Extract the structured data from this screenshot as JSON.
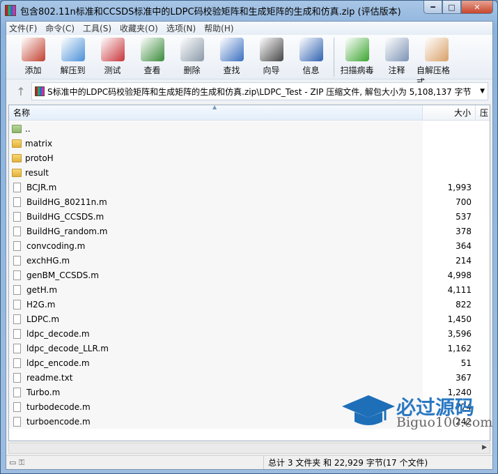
{
  "title": "包含802.11n标准和CCSDS标准中的LDPC码校验矩阵和生成矩阵的生成和仿真.zip (评估版本)",
  "menu": [
    "文件(F)",
    "命令(C)",
    "工具(S)",
    "收藏夹(O)",
    "选项(N)",
    "帮助(H)"
  ],
  "toolbar": [
    {
      "label": "添加",
      "color": "#c2402f"
    },
    {
      "label": "解压到",
      "color": "#4a90d8"
    },
    {
      "label": "测试",
      "color": "#c8343a"
    },
    {
      "label": "查看",
      "color": "#3a8a3a"
    },
    {
      "label": "删除",
      "color": "#8a99a8"
    },
    {
      "label": "查找",
      "color": "#3a6fc0"
    },
    {
      "label": "向导",
      "color": "#444444"
    },
    {
      "label": "信息",
      "color": "#2f62b0"
    }
  ],
  "toolbar2": [
    {
      "label": "扫描病毒",
      "color": "#3aa52e"
    },
    {
      "label": "注释",
      "color": "#7c93b4"
    },
    {
      "label": "自解压格式",
      "color": "#d9a068"
    }
  ],
  "address": "S标准中的LDPC码校验矩阵和生成矩阵的生成和仿真.zip\\LDPC_Test - ZIP 压缩文件, 解包大小为 5,108,137 字节",
  "columns": {
    "name": "名称",
    "size": "大小",
    "more": "压"
  },
  "files": [
    {
      "name": "..",
      "size": "",
      "type": "up"
    },
    {
      "name": "matrix",
      "size": "",
      "type": "folder"
    },
    {
      "name": "protoH",
      "size": "",
      "type": "folder"
    },
    {
      "name": "result",
      "size": "",
      "type": "folder"
    },
    {
      "name": "BCJR.m",
      "size": "1,993",
      "type": "file"
    },
    {
      "name": "BuildHG_80211n.m",
      "size": "700",
      "type": "file"
    },
    {
      "name": "BuildHG_CCSDS.m",
      "size": "537",
      "type": "file"
    },
    {
      "name": "BuildHG_random.m",
      "size": "378",
      "type": "file"
    },
    {
      "name": "convcoding.m",
      "size": "364",
      "type": "file"
    },
    {
      "name": "exchHG.m",
      "size": "214",
      "type": "file"
    },
    {
      "name": "genBM_CCSDS.m",
      "size": "4,998",
      "type": "file"
    },
    {
      "name": "getH.m",
      "size": "4,111",
      "type": "file"
    },
    {
      "name": "H2G.m",
      "size": "822",
      "type": "file"
    },
    {
      "name": "LDPC.m",
      "size": "1,450",
      "type": "file"
    },
    {
      "name": "ldpc_decode.m",
      "size": "3,596",
      "type": "file"
    },
    {
      "name": "ldpc_decode_LLR.m",
      "size": "1,162",
      "type": "file"
    },
    {
      "name": "ldpc_encode.m",
      "size": "51",
      "type": "file"
    },
    {
      "name": "readme.txt",
      "size": "367",
      "type": "file"
    },
    {
      "name": "Turbo.m",
      "size": "1,240",
      "type": "file"
    },
    {
      "name": "turbodecode.m",
      "size": "774",
      "type": "file"
    },
    {
      "name": "turboencode.m",
      "size": "242",
      "type": "file"
    }
  ],
  "status": {
    "right": "总计 3 文件夹 和 22,929 字节(17 个文件)"
  },
  "watermark": {
    "cn": "必过源码",
    "en": "Biguo100.com"
  }
}
